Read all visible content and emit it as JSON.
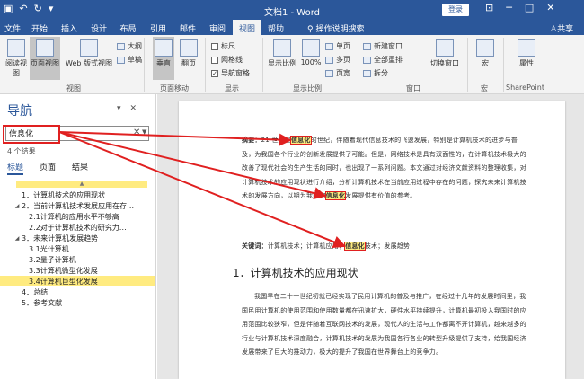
{
  "titlebar": {
    "doc_title": "文档1 - Word",
    "login": "登录",
    "qat": [
      "save-icon",
      "undo-icon",
      "redo-icon",
      "touch-mode-icon"
    ],
    "window_buttons": [
      "ribbon-display-icon",
      "minimize-icon",
      "restore-icon",
      "close-icon"
    ]
  },
  "tabs": {
    "items": [
      "文件",
      "开始",
      "插入",
      "设计",
      "布局",
      "引用",
      "邮件",
      "审阅",
      "视图",
      "帮助"
    ],
    "active": "视图",
    "search": "操作说明搜索",
    "share": "共享"
  },
  "ribbon": {
    "view_group": {
      "read_mode": "阅读视图",
      "print_layout": "页面视图",
      "web_layout": "Web 版式视图",
      "outline": "大纲",
      "draft": "草稿",
      "label": "视图"
    },
    "page_move": {
      "vertical": "垂直",
      "side": "翻页",
      "label": "页面移动"
    },
    "show": {
      "ruler": "标尺",
      "gridlines": "网格线",
      "nav_pane": "导航窗格",
      "ruler_checked": false,
      "gridlines_checked": false,
      "nav_pane_checked": true,
      "label": "显示"
    },
    "zoom": {
      "zoom": "显示比例",
      "percent": "100%",
      "one_page": "单页",
      "multi_page": "多页",
      "page_width": "页宽",
      "label": "显示比例"
    },
    "window": {
      "new_window": "新建窗口",
      "arrange_all": "全部重排",
      "split": "拆分",
      "switch": "切换窗口",
      "label": "窗口"
    },
    "macros": {
      "macros": "宏",
      "label": "宏"
    },
    "sharepoint": {
      "properties": "属性",
      "label": "SharePoint"
    }
  },
  "nav": {
    "title": "导航",
    "search_value": "信息化",
    "results": "4 个结果",
    "subtabs": [
      "标题",
      "页面",
      "结果"
    ],
    "active_subtab": "标题",
    "outline": [
      {
        "text": "1．计算机技术的应用现状",
        "level": 1,
        "arrow": "",
        "hl": false
      },
      {
        "text": "2．当前计算机技术发展应用在存…",
        "level": 1,
        "arrow": "◢",
        "hl": false
      },
      {
        "text": "2.1计算机的应用水平不够高",
        "level": 2,
        "arrow": "",
        "hl": false
      },
      {
        "text": "2.2对于计算机技术的研究力…",
        "level": 2,
        "arrow": "",
        "hl": false
      },
      {
        "text": "3．未来计算机发展趋势",
        "level": 1,
        "arrow": "◢",
        "hl": false
      },
      {
        "text": "3.1光计算机",
        "level": 2,
        "arrow": "",
        "hl": false
      },
      {
        "text": "3.2量子计算机",
        "level": 2,
        "arrow": "",
        "hl": false
      },
      {
        "text": "3.3计算机微型化发展",
        "level": 2,
        "arrow": "",
        "hl": false
      },
      {
        "text": "3.4计算机巨型化发展",
        "level": 2,
        "arrow": "",
        "hl": true
      },
      {
        "text": "4．总结",
        "level": 1,
        "arrow": "",
        "hl": false
      },
      {
        "text": "5．参考文献",
        "level": 1,
        "arrow": "",
        "hl": false
      }
    ]
  },
  "doc": {
    "abstract": {
      "label": "摘要：",
      "pre": "21 世纪是",
      "mark1": "信息化",
      "post1": "的世纪，伴随着现代信息技术的飞速发展，特别是计算机技术的进步与普及，为我国各个行业的创新发展提供了可能。但是，网络技术是具有双面性的，在计算机技术极大的改善了现代社会的生产生活的同时，也出现了一系列问题。本文通过对经济文献资料的整理收集，对计算机技术的应用现状进行介绍，分析计算机技术在当前应用过程中存在的问题，探究未来计算机技术的发展方向，以期为我国的",
      "mark2": "信息化",
      "post2": "发展提供有价值的参考。"
    },
    "keywords": {
      "label": "关键词：",
      "pre": "计算机技术；计算机应用；",
      "mark": "信息化",
      "post": "技术；发展趋势"
    },
    "heading": "1．计算机技术的应用现状",
    "body": "我国早在二十一世纪初就已经实现了民用计算机的普及与推广，在经过十几年的发展时间里，我国民用计算机的使用范围和使用数量都在迅速扩大，硬件水平持续提升，计算机最初投入我国时的应用范围比较狭窄，但是伴随着互联网技术的发展，现代人的生活与工作都离不开计算机，越来越多的行业与计算机技术深度融合，计算机技术的发展为我国各行各业的转型升级提供了支持，给我国经济发展带来了巨大的推动力，极大的提升了我国在世界舞台上的竞争力。"
  },
  "colors": {
    "brand": "#2b579a",
    "highlight": "#ffeb80",
    "callout": "#e02020"
  }
}
